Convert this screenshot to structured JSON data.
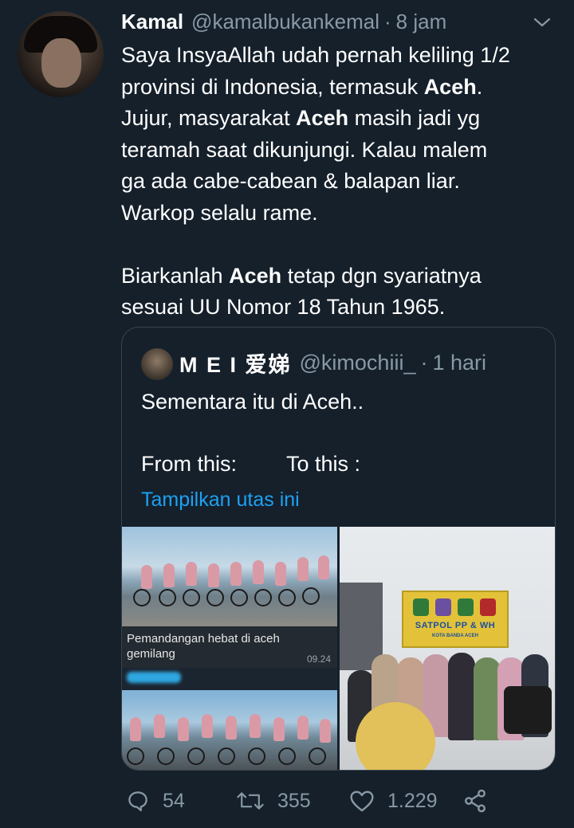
{
  "tweet": {
    "author_name": "Kamal",
    "author_handle": "@kamalbukankemal",
    "separator": "·",
    "time": "8 jam",
    "text_parts": [
      {
        "t": "Saya InsyaAllah udah pernah keliling 1/2\nprovinsi di Indonesia, termasuk ",
        "b": false
      },
      {
        "t": "Aceh",
        "b": true
      },
      {
        "t": ".\nJujur, masyarakat ",
        "b": false
      },
      {
        "t": "Aceh",
        "b": true
      },
      {
        "t": " masih jadi yg\nteramah saat dikunjungi. Kalau malem\nga ada cabe-cabean & balapan liar.\nWarkop selalu rame.\n\nBiarkanlah ",
        "b": false
      },
      {
        "t": "Aceh",
        "b": true
      },
      {
        "t": " tetap dgn syariatnya\nsesuai UU Nomor 18 Tahun 1965.",
        "b": false
      }
    ]
  },
  "quoted": {
    "author_name": "M E I 爱娣",
    "author_handle": "@kimochiii_",
    "separator": "·",
    "time": "1 hari",
    "line1": "Sementara itu di Aceh..",
    "from_text": "From this:",
    "to_text": "To this :",
    "show_thread": "Tampilkan utas ini",
    "media_left": {
      "caption": "Pemandangan hebat di aceh gemilang",
      "caption_time": "09.24"
    },
    "media_right": {
      "sign_title": "SATPOL PP & WH",
      "sign_sub": "KOTA BANDA ACEH"
    }
  },
  "actions": {
    "reply_count": "54",
    "retweet_count": "355",
    "like_count": "1.229"
  },
  "colors": {
    "background": "#15202b",
    "muted": "#8899a6",
    "link": "#1da1f2",
    "border": "#38444d"
  }
}
